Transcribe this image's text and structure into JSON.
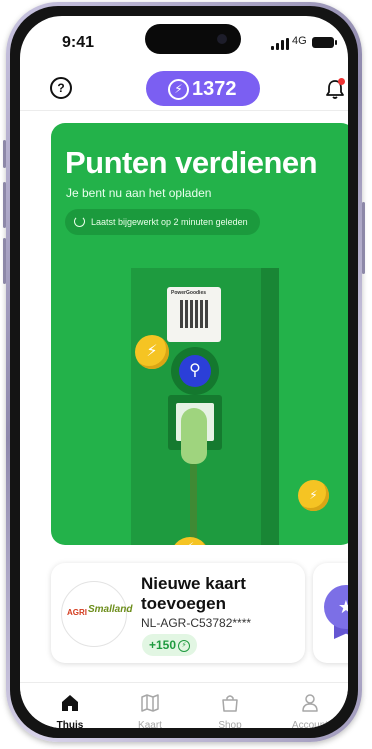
{
  "status_bar": {
    "time": "9:41",
    "network": "4G"
  },
  "header": {
    "points": "1372",
    "points_icon": "lightning-bolt-icon",
    "help_icon": "question-icon",
    "notification_icon": "bell-icon"
  },
  "hero": {
    "title": "Punten verdienen",
    "subtitle": "Je bent nu aan het opladen",
    "update_text": "Laatst bijgewerkt op 2 minuten geleden",
    "charger_brand": "PowerGoodies",
    "background_color": "#23b24a"
  },
  "cards": [
    {
      "title": "Nieuwe kaart toevoegen",
      "card_id": "NL-AGR-C53782****",
      "bonus": "+150",
      "logo_text_1": "AGRI",
      "logo_text_2": "Smalland"
    }
  ],
  "tabs": [
    {
      "label": "Thuis",
      "icon": "home-icon",
      "active": true
    },
    {
      "label": "Kaart",
      "icon": "map-icon",
      "active": false
    },
    {
      "label": "Shop",
      "icon": "shopping-bag-icon",
      "active": false
    },
    {
      "label": "Account",
      "icon": "user-icon",
      "active": false
    }
  ],
  "colors": {
    "accent_purple": "#7b5ff2",
    "brand_green": "#23b24a",
    "coin_yellow": "#f5c423"
  }
}
